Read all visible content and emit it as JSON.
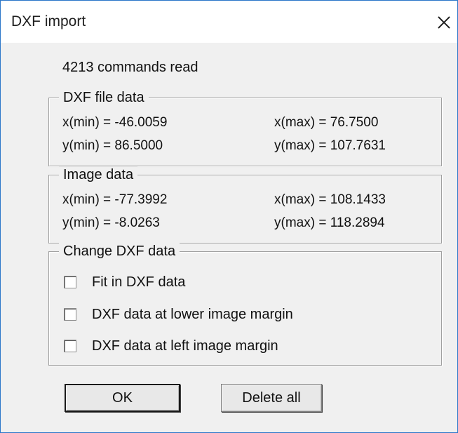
{
  "window": {
    "title": "DXF import",
    "close_icon": "close-icon"
  },
  "status": {
    "commands_read": "4213 commands read"
  },
  "dxf_file_data": {
    "title": "DXF file data",
    "xmin": "x(min) = -46.0059",
    "xmax": "x(max) = 76.7500",
    "ymin": "y(min) = 86.5000",
    "ymax": "y(max) = 107.7631"
  },
  "image_data": {
    "title": "Image data",
    "xmin": "x(min) = -77.3992",
    "xmax": "x(max) = 108.1433",
    "ymin": "y(min) = -8.0263",
    "ymax": "y(max) = 118.2894"
  },
  "change_dxf_data": {
    "title": "Change DXF data",
    "options": [
      {
        "label": "Fit in DXF data",
        "checked": false
      },
      {
        "label": "DXF data at lower image margin",
        "checked": false
      },
      {
        "label": "DXF data at left image margin",
        "checked": false
      }
    ]
  },
  "buttons": {
    "ok": "OK",
    "delete_all": "Delete all"
  }
}
